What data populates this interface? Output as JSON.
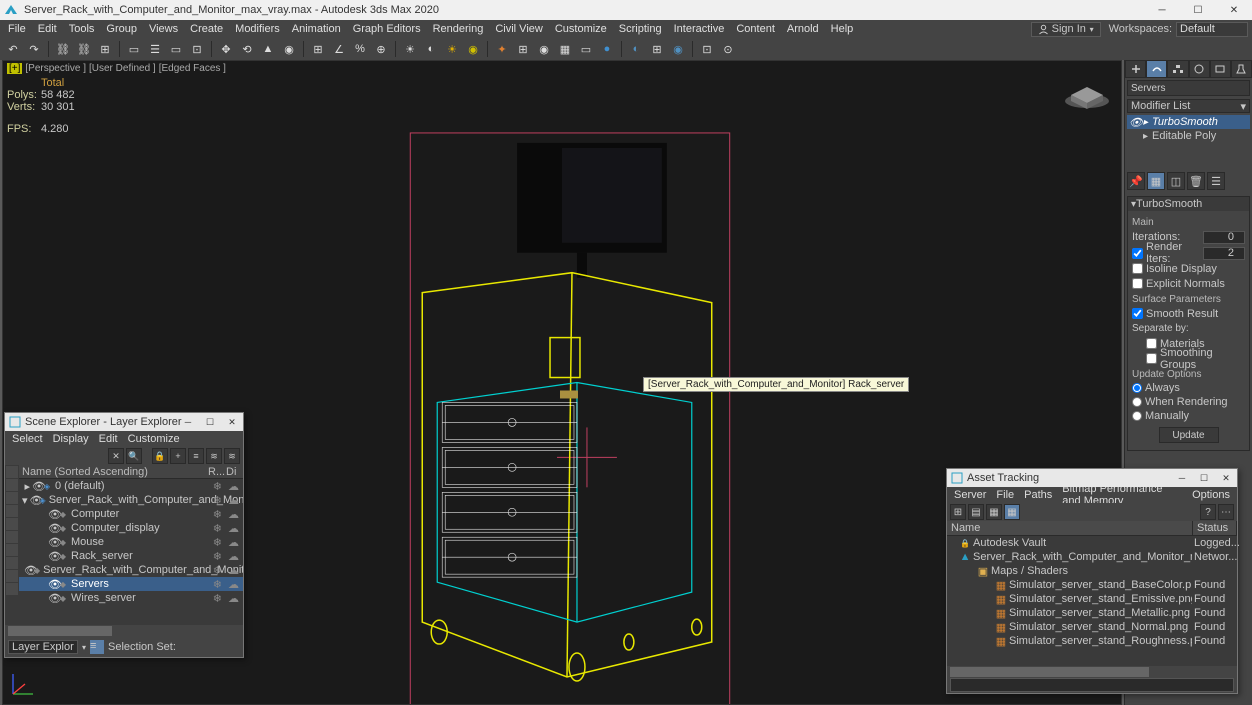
{
  "titlebar": {
    "icon_color": "#2a9fc4",
    "title": "Server_Rack_with_Computer_and_Monitor_max_vray.max - Autodesk 3ds Max 2020"
  },
  "menus": [
    "File",
    "Edit",
    "Tools",
    "Group",
    "Views",
    "Create",
    "Modifiers",
    "Animation",
    "Graph Editors",
    "Rendering",
    "Civil View",
    "Customize",
    "Scripting",
    "Interactive",
    "Content",
    "Arnold",
    "Help"
  ],
  "signin": {
    "label": "Sign In"
  },
  "workspaces": {
    "label": "Workspaces:",
    "value": "Default"
  },
  "viewport": {
    "labels": [
      "[+]",
      "[Perspective ]",
      "[User Defined ]",
      "[Edged Faces ]"
    ],
    "stats_header": "Total",
    "polys_lbl": "Polys:",
    "polys": "58 482",
    "verts_lbl": "Verts:",
    "verts": "30 301",
    "fps_lbl": "FPS:",
    "fps": "4.280",
    "tooltip": "[Server_Rack_with_Computer_and_Monitor] Rack_server"
  },
  "cmdpanel": {
    "name": "Servers",
    "modifier_list": "Modifier List",
    "stack": [
      {
        "label": "TurboSmooth",
        "sel": true
      },
      {
        "label": "Editable Poly",
        "sel": false
      }
    ],
    "rollup_title": "TurboSmooth",
    "main_lbl": "Main",
    "iterations_lbl": "Iterations:",
    "iterations": "0",
    "render_iters_lbl": "Render Iters:",
    "render_iters": "2",
    "render_iters_chk": true,
    "isoline_lbl": "Isoline Display",
    "isoline_chk": false,
    "explicit_lbl": "Explicit Normals",
    "explicit_chk": false,
    "surface_lbl": "Surface Parameters",
    "smooth_res_lbl": "Smooth Result",
    "smooth_res_chk": true,
    "separate_lbl": "Separate by:",
    "materials_lbl": "Materials",
    "materials_chk": false,
    "smoothing_lbl": "Smoothing Groups",
    "smoothing_chk": false,
    "update_lbl": "Update Options",
    "always_lbl": "Always",
    "when_rendering_lbl": "When Rendering",
    "manually_lbl": "Manually",
    "update_btn": "Update"
  },
  "scene_explorer": {
    "title": "Scene Explorer - Layer Explorer",
    "menus": [
      "Select",
      "Display",
      "Edit",
      "Customize"
    ],
    "name_header": "Name (Sorted Ascending)",
    "col2": "R...",
    "col3": "Di",
    "rows": [
      {
        "indent": 0,
        "icon": "layer",
        "label": "0 (default)",
        "sel": false,
        "exp": "▸"
      },
      {
        "indent": 0,
        "icon": "layer",
        "label": "Server_Rack_with_Computer_and_Monitor",
        "sel": false,
        "exp": "▾"
      },
      {
        "indent": 1,
        "icon": "obj",
        "label": "Computer",
        "sel": false,
        "exp": ""
      },
      {
        "indent": 1,
        "icon": "obj",
        "label": "Computer_display",
        "sel": false,
        "exp": ""
      },
      {
        "indent": 1,
        "icon": "obj",
        "label": "Mouse",
        "sel": false,
        "exp": ""
      },
      {
        "indent": 1,
        "icon": "obj",
        "label": "Rack_server",
        "sel": false,
        "exp": ""
      },
      {
        "indent": 1,
        "icon": "obj",
        "label": "Server_Rack_with_Computer_and_Monitor",
        "sel": false,
        "exp": ""
      },
      {
        "indent": 1,
        "icon": "obj",
        "label": "Servers",
        "sel": true,
        "exp": ""
      },
      {
        "indent": 1,
        "icon": "obj",
        "label": "Wires_server",
        "sel": false,
        "exp": ""
      }
    ],
    "bottom": {
      "label": "Layer Explorer",
      "sel_set_lbl": "Selection Set:"
    }
  },
  "asset_tracking": {
    "title": "Asset Tracking",
    "menus": [
      "Server",
      "File",
      "Paths",
      "Bitmap Performance and Memory",
      "Options"
    ],
    "name_col": "Name",
    "status_col": "Status",
    "rows": [
      {
        "indent": 0,
        "icon": "vault",
        "label": "Autodesk Vault",
        "status": "Logged..."
      },
      {
        "indent": 0,
        "icon": "max",
        "label": "Server_Rack_with_Computer_and_Monitor_max_vray.max",
        "status": "Networ..."
      },
      {
        "indent": 1,
        "icon": "folder",
        "label": "Maps / Shaders",
        "status": ""
      },
      {
        "indent": 2,
        "icon": "img",
        "label": "Simulator_server_stand_BaseColor.png",
        "status": "Found"
      },
      {
        "indent": 2,
        "icon": "img",
        "label": "Simulator_server_stand_Emissive.png",
        "status": "Found"
      },
      {
        "indent": 2,
        "icon": "img",
        "label": "Simulator_server_stand_Metallic.png",
        "status": "Found"
      },
      {
        "indent": 2,
        "icon": "img",
        "label": "Simulator_server_stand_Normal.png",
        "status": "Found"
      },
      {
        "indent": 2,
        "icon": "img",
        "label": "Simulator_server_stand_Roughness.png",
        "status": "Found"
      }
    ]
  }
}
